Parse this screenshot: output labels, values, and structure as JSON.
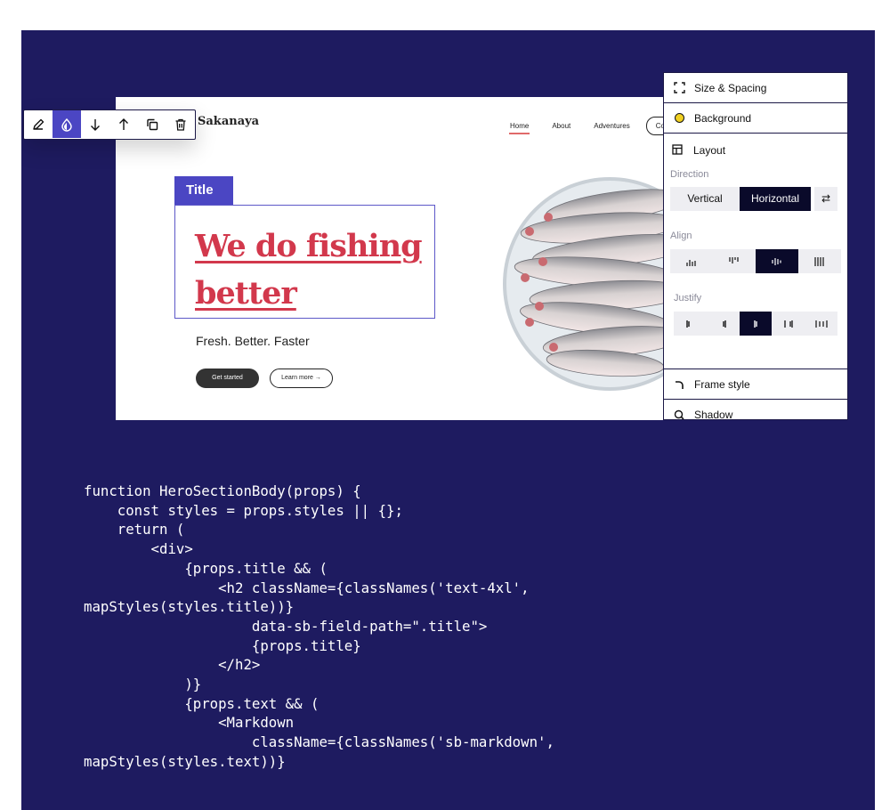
{
  "site": {
    "brand": "Sakanaya",
    "nav": [
      "Home",
      "About",
      "Adventures"
    ],
    "nav_cta": "Co",
    "title_tag": "Title",
    "hero_title": "We do fishing better",
    "hero_subtitle": "Fresh. Better. Faster",
    "btn_primary": "Get started",
    "btn_secondary": "Learn more →"
  },
  "toolbar": {
    "buttons": [
      "pencil-icon",
      "droplet-icon",
      "arrow-down-icon",
      "arrow-up-icon",
      "duplicate-icon",
      "trash-icon"
    ],
    "active": "droplet-icon"
  },
  "panel": {
    "size_spacing": "Size & Spacing",
    "background": "Background",
    "layout": "Layout",
    "direction_label": "Direction",
    "direction_options": [
      "Vertical",
      "Horizontal"
    ],
    "direction_selected": "Horizontal",
    "align_label": "Align",
    "justify_label": "Justify",
    "frame_style": "Frame style",
    "shadow": "Shadow"
  },
  "colors": {
    "stage": "#1e1b60",
    "accent": "#4b46c3",
    "title_red": "#d2384c",
    "background_swatch": "#f0d022"
  },
  "code": {
    "lines": [
      "function HeroSectionBody(props) {",
      "    const styles = props.styles || {};",
      "    return (",
      "        <div>",
      "            {props.title && (",
      "                <h2 className={classNames('text-4xl',",
      "mapStyles(styles.title))}",
      "                    data-sb-field-path=\".title\">",
      "                    {props.title}",
      "                </h2>",
      "            )}",
      "            {props.text && (",
      "                <Markdown",
      "                    className={classNames('sb-markdown',",
      "mapStyles(styles.text))}"
    ]
  }
}
